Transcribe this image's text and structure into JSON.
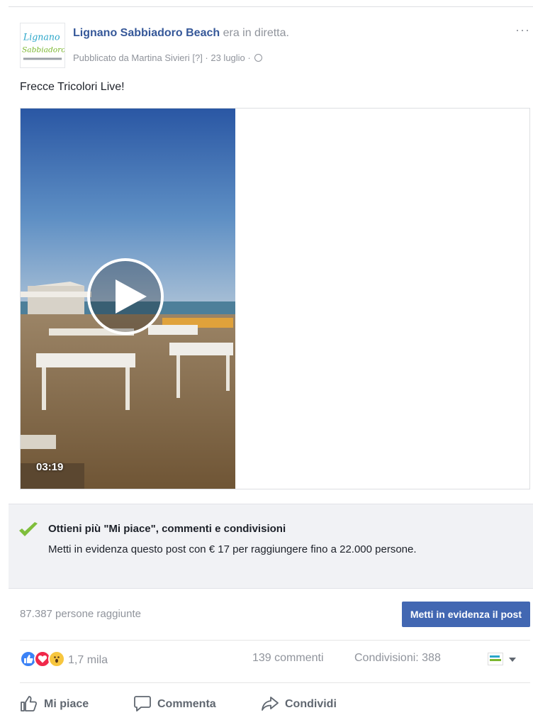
{
  "post": {
    "page_name": "Lignano Sabbiadoro Beach",
    "live_status": " era in diretta.",
    "meta": "Pubblicato da Martina Sivieri [?] · 23 luglio · ",
    "more_menu": "···",
    "avatar_logo_line1": "Lignano",
    "avatar_logo_line2": "Sabbiadoro",
    "text": "Frecce Tricolori Live!",
    "video": {
      "duration": "03:19"
    }
  },
  "boost_panel": {
    "title": "Ottieni più \"Mi piace\", commenti e condivisioni",
    "description": "Metti in evidenza questo post con € 17 per raggiungere fino a 22.000 persone.",
    "icon": "check-icon",
    "color": "#7fbe3c"
  },
  "reach": {
    "text": "87.387 persone raggiunte",
    "boost_button": "Metti in evidenza il post",
    "button_color": "#4267b2"
  },
  "stats": {
    "reactions": [
      "like",
      "love",
      "wow"
    ],
    "reaction_count": "1,7 mila",
    "comments": "139 commenti",
    "shares": "Condivisioni: 388"
  },
  "actions": {
    "like": "Mi piace",
    "comment": "Commenta",
    "share": "Condividi"
  }
}
